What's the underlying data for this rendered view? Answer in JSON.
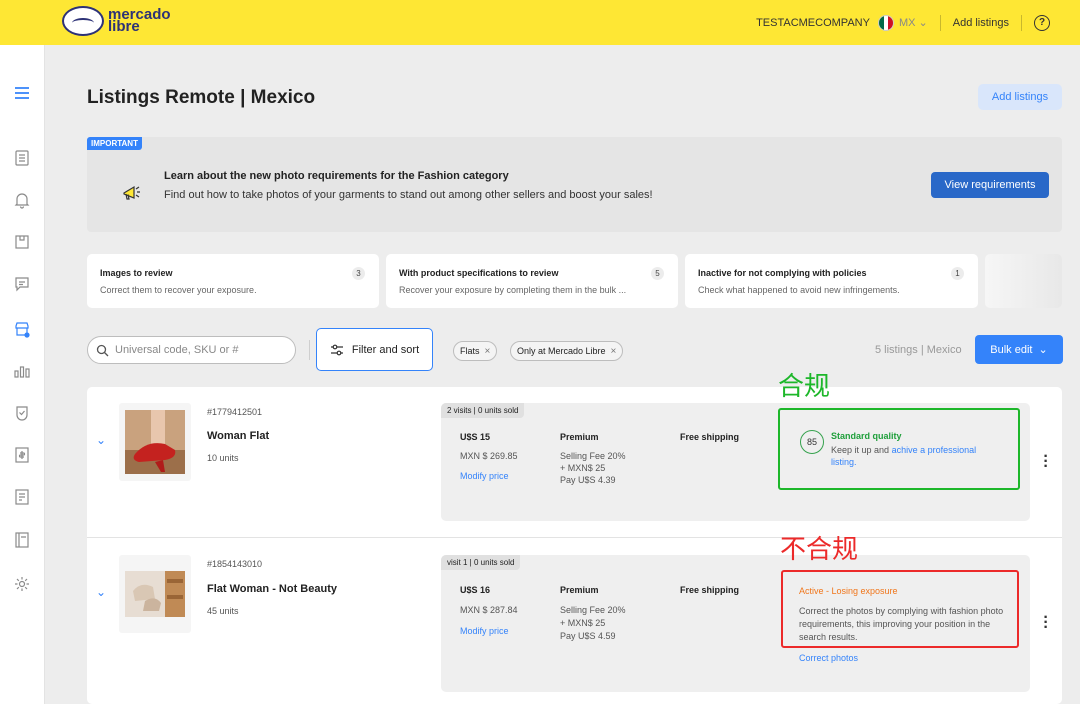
{
  "header": {
    "logo_line1": "mercado",
    "logo_line2": "libre",
    "account": "TESTACMECOMPANY",
    "country": "MX",
    "add_listings": "Add listings",
    "help": "?"
  },
  "page": {
    "title": "Listings Remote | Mexico",
    "add_listings_button": "Add listings"
  },
  "banner": {
    "tag": "IMPORTANT",
    "title": "Learn about the new photo requirements for the Fashion category",
    "description": "Find out how to take photos of your garments to stand out among other sellers and boost your sales!",
    "button": "View requirements"
  },
  "cards": [
    {
      "title": "Images to review",
      "description": "Correct them to recover your exposure.",
      "count": "3"
    },
    {
      "title": "With product specifications to review",
      "description": "Recover your exposure by completing them in the bulk ...",
      "count": "5"
    },
    {
      "title": "Inactive for not complying with policies",
      "description": "Check what happened to avoid new infringements.",
      "count": "1"
    }
  ],
  "toolbar": {
    "search_placeholder": "Universal code, SKU or #",
    "filter_button": "Filter and sort",
    "chips": [
      "Flats",
      "Only at Mercado Libre"
    ],
    "listing_count": "5 listings | Mexico",
    "bulk_edit": "Bulk edit"
  },
  "listings": [
    {
      "sku": "#1779412501",
      "title": "Woman Flat",
      "units": "10 units",
      "visits": "2 visits | 0 units sold",
      "price": "U$S 15",
      "price_local": "MXN $ 269.85",
      "modify_price": "Modify price",
      "type": "Premium",
      "fee_line1": "Selling Fee 20%",
      "fee_line2": "+ MXN$ 25",
      "fee_line3": "Pay U$S 4.39",
      "shipping": "Free shipping",
      "quality_score": "85",
      "status_title": "Standard quality",
      "status_desc": "Keep it up and",
      "status_link": "achive a professional listing.",
      "annotation": "合规"
    },
    {
      "sku": "#1854143010",
      "title": "Flat Woman - Not Beauty",
      "units": "45 units",
      "visits": "visit 1 | 0 units sold",
      "price": "U$S 16",
      "price_local": "MXN $ 287.84",
      "modify_price": "Modify price",
      "type": "Premium",
      "fee_line1": "Selling Fee 20%",
      "fee_line2": "+ MXN$ 25",
      "fee_line3": "Pay U$S 4.59",
      "shipping": "Free shipping",
      "status_title": "Active - Losing exposure",
      "status_desc": "Correct the photos by complying with fashion photo requirements, this improving your position in the search results.",
      "status_link": "Correct photos",
      "annotation": "不合规"
    }
  ],
  "colors": {
    "brand_yellow": "#fee734",
    "accent_blue": "#3483fa",
    "compliant_green": "#1db72a",
    "noncompliant_red": "#ec2a2a"
  }
}
